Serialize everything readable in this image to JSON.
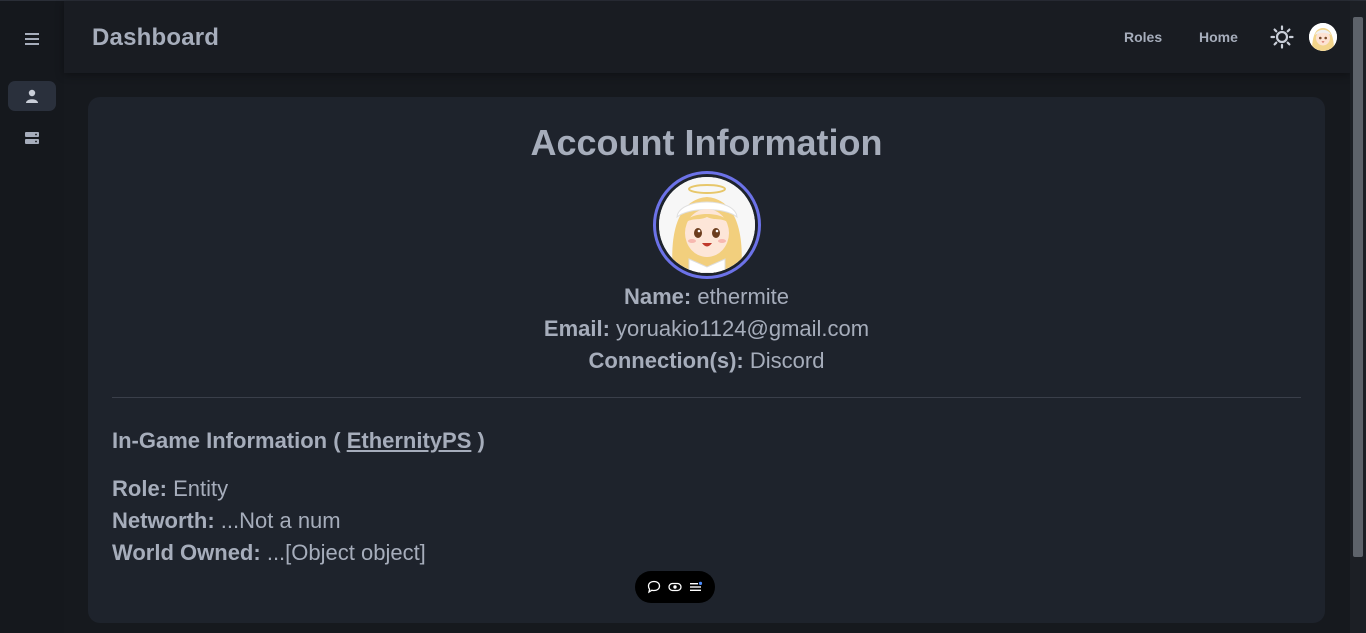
{
  "header": {
    "title": "Dashboard",
    "nav": [
      {
        "label": "Roles"
      },
      {
        "label": "Home"
      }
    ]
  },
  "sidebar": {
    "items": [
      {
        "icon": "user-icon",
        "active": true
      },
      {
        "icon": "server-icon",
        "active": false
      }
    ]
  },
  "account": {
    "title": "Account Information",
    "name_label": "Name:",
    "name_value": "ethermite",
    "email_label": "Email:",
    "email_value": "yoruakio1124@gmail.com",
    "connections_label": "Connection(s):",
    "connections_value": "Discord"
  },
  "ingame": {
    "title_prefix": "In-Game Information ( ",
    "server_link": "EthernityPS",
    "title_suffix": " )",
    "role_label": "Role:",
    "role_value": "Entity",
    "networth_label": "Networth:",
    "networth_value": "...Not a num",
    "world_label": "World Owned:",
    "world_value": "...[Object object]"
  },
  "colors": {
    "accent_ring": "#6c72e8",
    "card_bg": "#1e232c",
    "text": "#a6adbb"
  }
}
